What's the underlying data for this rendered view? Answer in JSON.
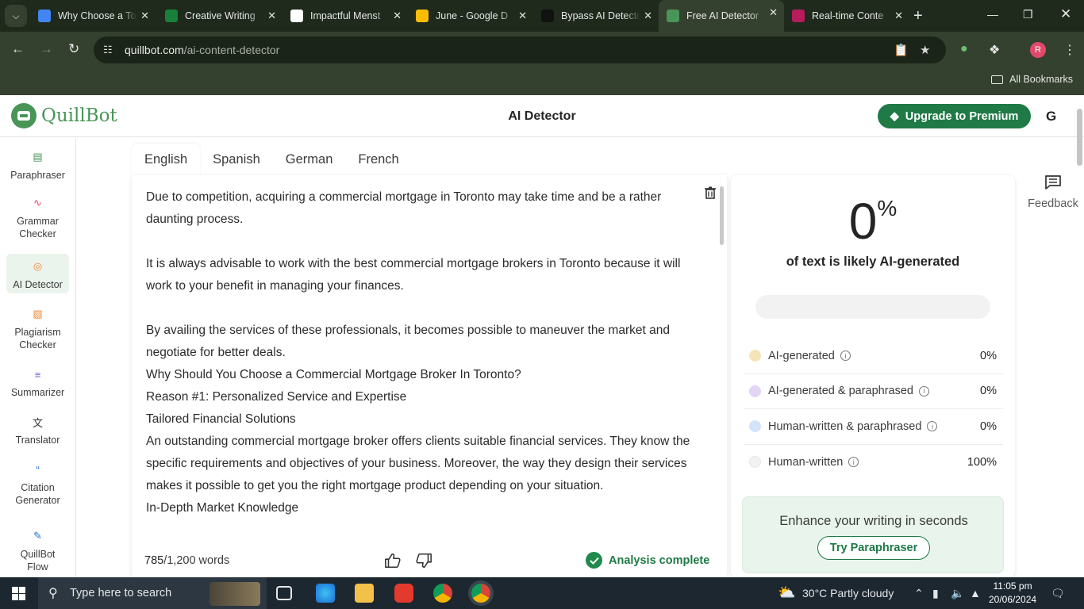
{
  "browser": {
    "tabs": [
      {
        "title": "Why Choose a Top",
        "favicon_color": "#4285f4"
      },
      {
        "title": "Creative Writing",
        "favicon_color": "#188038"
      },
      {
        "title": "Impactful Menst",
        "favicon_color": "#ffffff"
      },
      {
        "title": "June - Google D",
        "favicon_color": "#fbbc04"
      },
      {
        "title": "Bypass AI Detecto",
        "favicon_color": "#111111"
      },
      {
        "title": "Free AI Detector",
        "favicon_color": "#499557",
        "active": true
      },
      {
        "title": "Real-time Conte",
        "favicon_color": "#b71c5b"
      }
    ],
    "url_host": "quillbot.com",
    "url_path": "/ai-content-detector",
    "bookmarks_label": "All Bookmarks",
    "profile_initial": "R"
  },
  "app": {
    "logo_text": "QuillBot",
    "title": "AI Detector",
    "upgrade_label": "Upgrade to Premium",
    "user_initial": "G",
    "brand_color": "#499557",
    "accent_color": "#1f7a46"
  },
  "sidebar": {
    "items": [
      {
        "label": "Paraphraser",
        "icon": "paraphraser-icon",
        "color": "#499557"
      },
      {
        "label": "Grammar Checker",
        "icon": "grammar-icon",
        "color": "#e74c5b"
      },
      {
        "label": "AI Detector",
        "icon": "ai-detector-icon",
        "color": "#f08a3c",
        "active": true
      },
      {
        "label": "Plagiarism Checker",
        "icon": "plagiarism-icon",
        "color": "#f08a3c"
      },
      {
        "label": "Summarizer",
        "icon": "summarizer-icon",
        "color": "#7b5cd6"
      },
      {
        "label": "Translator",
        "icon": "translator-icon",
        "color": "#333333"
      },
      {
        "label": "Citation Generator",
        "icon": "citation-icon",
        "color": "#2a6fd6"
      },
      {
        "label": "QuillBot Flow",
        "icon": "flow-icon",
        "color": "#2a6fd6"
      }
    ]
  },
  "editor": {
    "languages": [
      "English",
      "Spanish",
      "German",
      "French"
    ],
    "paragraphs": [
      "Due to competition, acquiring a commercial mortgage in Toronto may take time and be a rather daunting process.",
      "",
      "It is always advisable to work with the best commercial mortgage brokers in Toronto because it will work to your benefit in managing your finances.",
      "",
      "By availing the services of these professionals, it becomes possible to maneuver the market and negotiate for better deals.",
      "Why Should You Choose a Commercial Mortgage Broker In Toronto?",
      "Reason #1: Personalized Service and Expertise",
      "Tailored Financial Solutions",
      "An outstanding commercial mortgage broker offers clients suitable financial services. They know the specific requirements and objectives of your business. Moreover, the way they design their services makes it possible to get you the right mortgage product depending on your situation.",
      "In-Depth Market Knowledge"
    ],
    "word_count": "785",
    "word_limit": "/1,200 words",
    "status": "Analysis complete"
  },
  "results": {
    "score": "0",
    "score_unit": "%",
    "caption": "of text is likely AI-generated",
    "ai_fraction": 0,
    "legend": [
      {
        "label": "AI-generated",
        "value": "0%",
        "color": "#f6e3b8"
      },
      {
        "label": "AI-generated & paraphrased",
        "value": "0%",
        "color": "#e4d4f5"
      },
      {
        "label": "Human-written & paraphrased",
        "value": "0%",
        "color": "#d3e3fa"
      },
      {
        "label": "Human-written",
        "value": "100%",
        "color": "#f2f2f2"
      }
    ],
    "enhance_text": "Enhance your writing in seconds",
    "try_label": "Try Paraphraser"
  },
  "feedback_label": "Feedback",
  "taskbar": {
    "search_placeholder": "Type here to search",
    "weather": "30°C  Partly cloudy",
    "time": "11:05 pm",
    "date": "20/06/2024"
  }
}
